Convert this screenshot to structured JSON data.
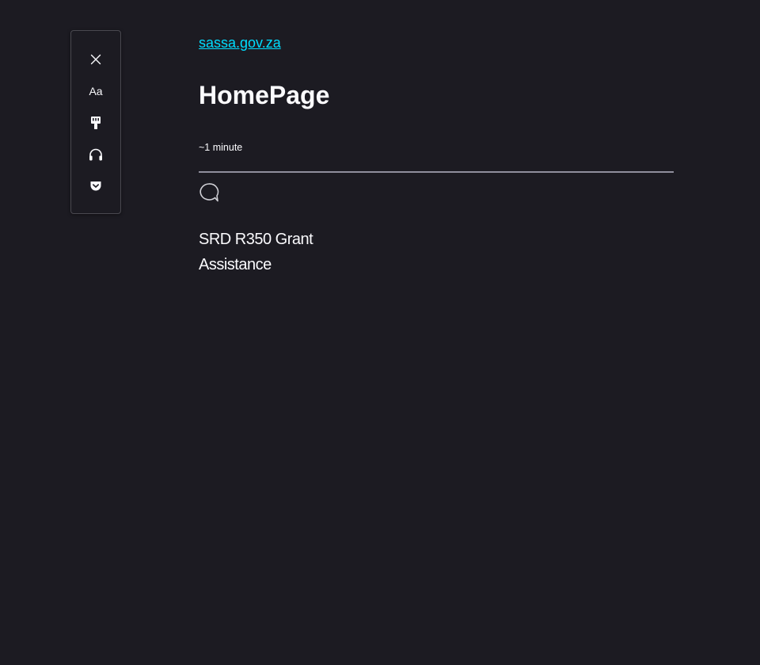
{
  "toolbar": {
    "close_label": "Close Reader View",
    "type_label": "Aa",
    "theme_label": "Theme",
    "listen_label": "Listen",
    "pocket_label": "Save to Pocket"
  },
  "article": {
    "domain": "sassa.gov.za",
    "title": "HomePage",
    "reading_time": "~1 minute",
    "paragraphs": [
      "SRD R350 Grant",
      "Assistance"
    ]
  },
  "colors": {
    "background": "#1c1b22",
    "text": "#fbfbfe",
    "link": "#00ddff",
    "divider": "#8f8f9d"
  },
  "icons": {
    "close": "close-icon",
    "type": "type-controls-icon",
    "theme": "paint-brush-icon",
    "listen": "headphones-icon",
    "pocket": "pocket-icon",
    "comment": "speech-bubble-icon"
  }
}
